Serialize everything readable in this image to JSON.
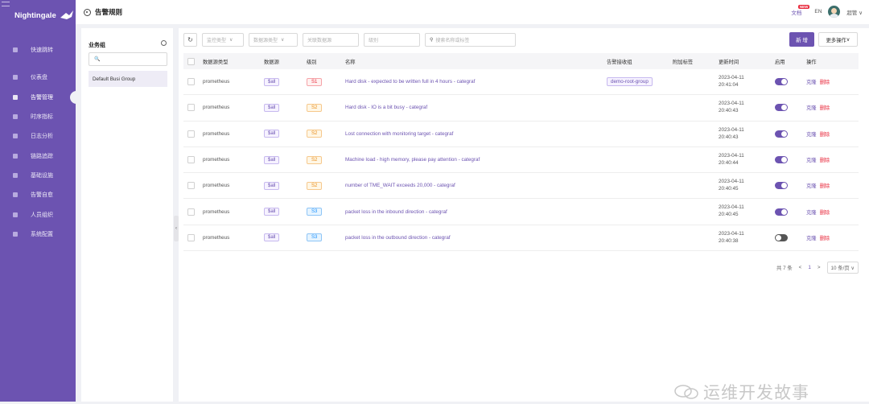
{
  "app": {
    "logo_text": "Nightingale"
  },
  "sidebar": {
    "items": [
      {
        "label": "快速跳转",
        "name": "sidebar-item-quick-jump",
        "icon": "search-icon"
      },
      {
        "label": "仪表盘",
        "name": "sidebar-item-dashboard",
        "icon": "dashboard-icon"
      },
      {
        "label": "告警管理",
        "name": "sidebar-item-alert-management",
        "icon": "bell-icon",
        "active": true
      },
      {
        "label": "时序指标",
        "name": "sidebar-item-metrics",
        "icon": "chart-icon"
      },
      {
        "label": "日志分析",
        "name": "sidebar-item-log-analysis",
        "icon": "log-icon"
      },
      {
        "label": "链路追踪",
        "name": "sidebar-item-tracing",
        "icon": "trace-icon"
      },
      {
        "label": "基础设施",
        "name": "sidebar-item-infrastructure",
        "icon": "server-icon"
      },
      {
        "label": "告警自愈",
        "name": "sidebar-item-alert-self-healing",
        "icon": "terminal-icon"
      },
      {
        "label": "人员组织",
        "name": "sidebar-item-users",
        "icon": "user-icon"
      },
      {
        "label": "系统配置",
        "name": "sidebar-item-system-config",
        "icon": "grid-icon"
      }
    ]
  },
  "header": {
    "title": "告警规则",
    "docs_label": "文档",
    "new_badge": "NEW",
    "lang": "EN",
    "user": "超管"
  },
  "left_panel": {
    "title": "业务组",
    "search_icon": "🔍",
    "groups": [
      "Default Busi Group"
    ]
  },
  "toolbar": {
    "refresh": "↻",
    "filters": [
      "监控类型",
      "数据源类型",
      "关联数据源",
      "级别",
      "搜索名称或标签"
    ],
    "new_label": "新 增",
    "more_label": "更多操作"
  },
  "table": {
    "headers": [
      "数据源类型",
      "数据源",
      "级别",
      "名称",
      "告警接收组",
      "附加标签",
      "更新时间",
      "启用",
      "操作"
    ],
    "rows": [
      {
        "type": "prometheus",
        "ds": "$all",
        "sev": "S1",
        "sev_class": "s1",
        "name": "Hard disk - expected to be written full in 4 hours - categraf",
        "group": "demo-root-group",
        "date": "2023-04-11",
        "time": "20:41:04",
        "enabled": true
      },
      {
        "type": "prometheus",
        "ds": "$all",
        "sev": "S2",
        "sev_class": "s2",
        "name": "Hard disk - IO is a bit busy - categraf",
        "group": "",
        "date": "2023-04-11",
        "time": "20:40:43",
        "enabled": true
      },
      {
        "type": "prometheus",
        "ds": "$all",
        "sev": "S2",
        "sev_class": "s2",
        "name": "Lost connection with monitoring target - categraf",
        "group": "",
        "date": "2023-04-11",
        "time": "20:40:43",
        "enabled": true
      },
      {
        "type": "prometheus",
        "ds": "$all",
        "sev": "S2",
        "sev_class": "s2",
        "name": "Machine load - high memory, please pay attention - categraf",
        "group": "",
        "date": "2023-04-11",
        "time": "20:40:44",
        "enabled": true
      },
      {
        "type": "prometheus",
        "ds": "$all",
        "sev": "S2",
        "sev_class": "s2",
        "name": "number of TME_WAIT exceeds 20,000 - categraf",
        "group": "",
        "date": "2023-04-11",
        "time": "20:40:45",
        "enabled": true
      },
      {
        "type": "prometheus",
        "ds": "$all",
        "sev": "S3",
        "sev_class": "s3",
        "name": "packet loss in the inbound direction - categraf",
        "group": "",
        "date": "2023-04-11",
        "time": "20:40:45",
        "enabled": true
      },
      {
        "type": "prometheus",
        "ds": "$all",
        "sev": "S3",
        "sev_class": "s3",
        "name": "packet loss in the outbound direction - categraf",
        "group": "",
        "date": "2023-04-11",
        "time": "20:40:38",
        "enabled": false
      }
    ],
    "actions": {
      "clone": "克隆",
      "delete": "删除"
    }
  },
  "pager": {
    "total": "共 7 条",
    "prev": "<",
    "page": "1",
    "next": ">",
    "size": "10 条/页"
  },
  "watermark": {
    "text": "运维开发故事"
  },
  "colors": {
    "accent": "#6c53b1",
    "danger": "#e8283b"
  }
}
